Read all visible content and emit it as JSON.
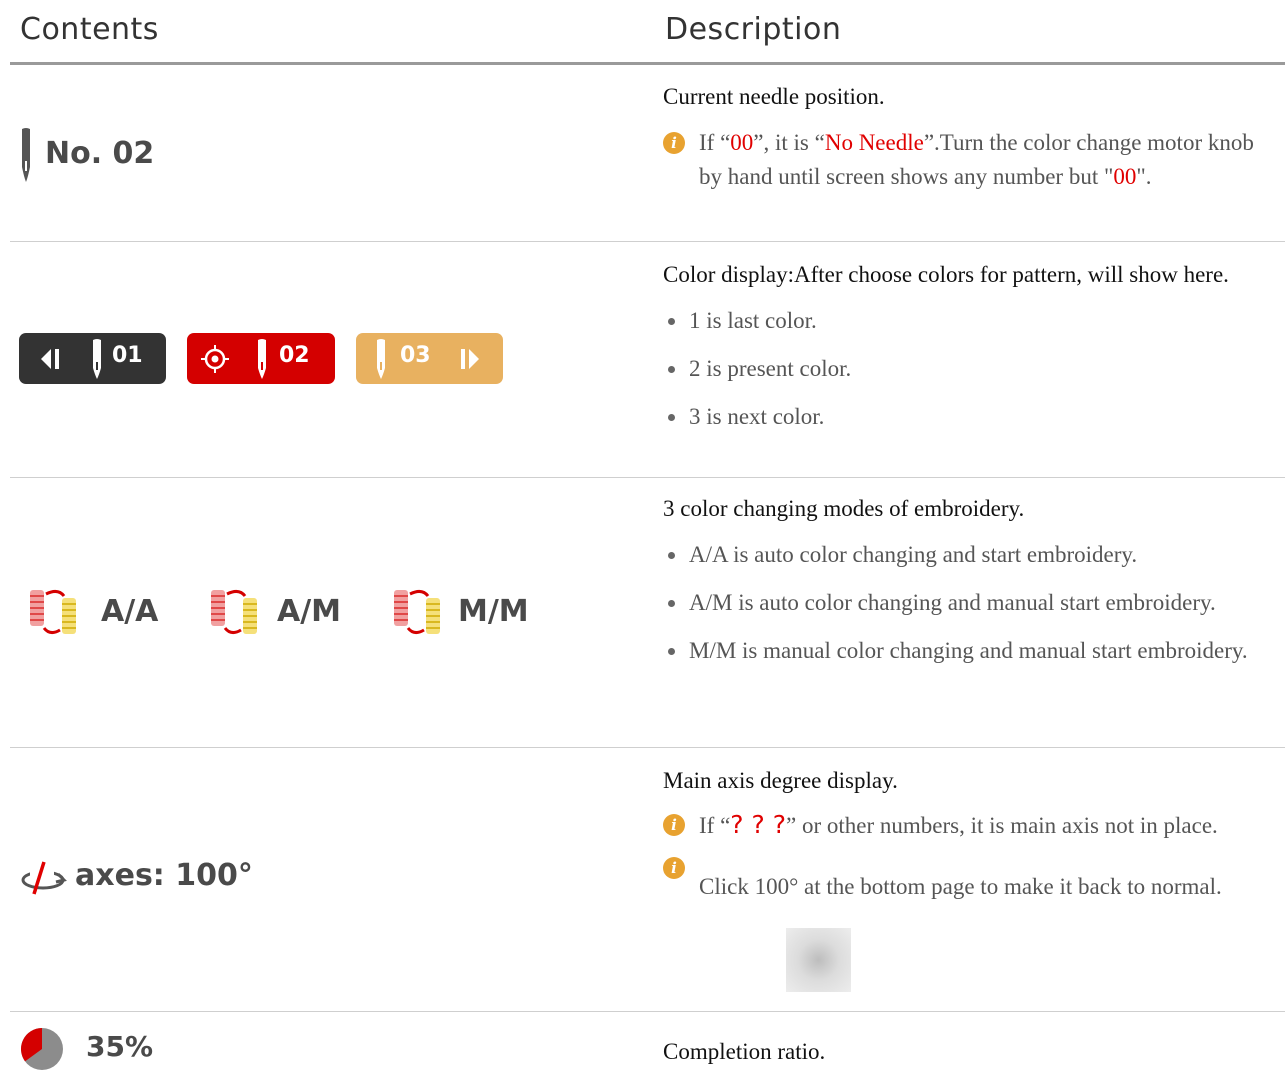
{
  "header": {
    "contents": "Contents",
    "description": "Description"
  },
  "row1": {
    "content_label": "No. 02",
    "desc_lead": "Current needle position.",
    "note": {
      "p1": "If “",
      "v1": "00",
      "p2": "”,   it is “",
      "v2": "No Needle",
      "p3": "”.Turn the color change motor knob by hand until screen shows any number but \"",
      "v3": "00",
      "p4": "\"."
    }
  },
  "row2": {
    "pills": [
      {
        "label": "01",
        "color": "#333333"
      },
      {
        "label": "02",
        "color": "#d40000"
      },
      {
        "label": "03",
        "color": "#e8b160"
      }
    ],
    "desc_lead": "Color display:After choose colors for pattern, will show here.",
    "bullets": [
      "1 is last color.",
      "2 is present color.",
      "3 is next color."
    ]
  },
  "row3": {
    "modes": [
      "A/A",
      "A/M",
      "M/M"
    ],
    "desc_lead": "3 color changing modes of embroidery.",
    "bullets": [
      "A/A is auto color changing and start embroidery.",
      "A/M is auto color changing and manual start embroidery.",
      "M/M is manual color changing and manual start embroidery."
    ]
  },
  "row4": {
    "content_label": "axes: 100°",
    "desc_lead": "Main axis degree display.",
    "note1": {
      "p1": "If “",
      "v1": "? ? ?",
      "p2": "” or other numbers, it is main axis not in place."
    },
    "note2": "Click 100° at the bottom page to make it back to normal."
  },
  "row5": {
    "content_label": "35%",
    "progress": 0.35,
    "desc_lead": "Completion ratio."
  },
  "colors": {
    "accent_red": "#e00000",
    "info_orange": "#e8a230"
  },
  "icons": [
    "needle-icon",
    "prev-icon",
    "target-icon",
    "next-icon",
    "thread-cycle-icon",
    "axis-rotate-icon",
    "pie-progress-icon",
    "info-icon"
  ]
}
